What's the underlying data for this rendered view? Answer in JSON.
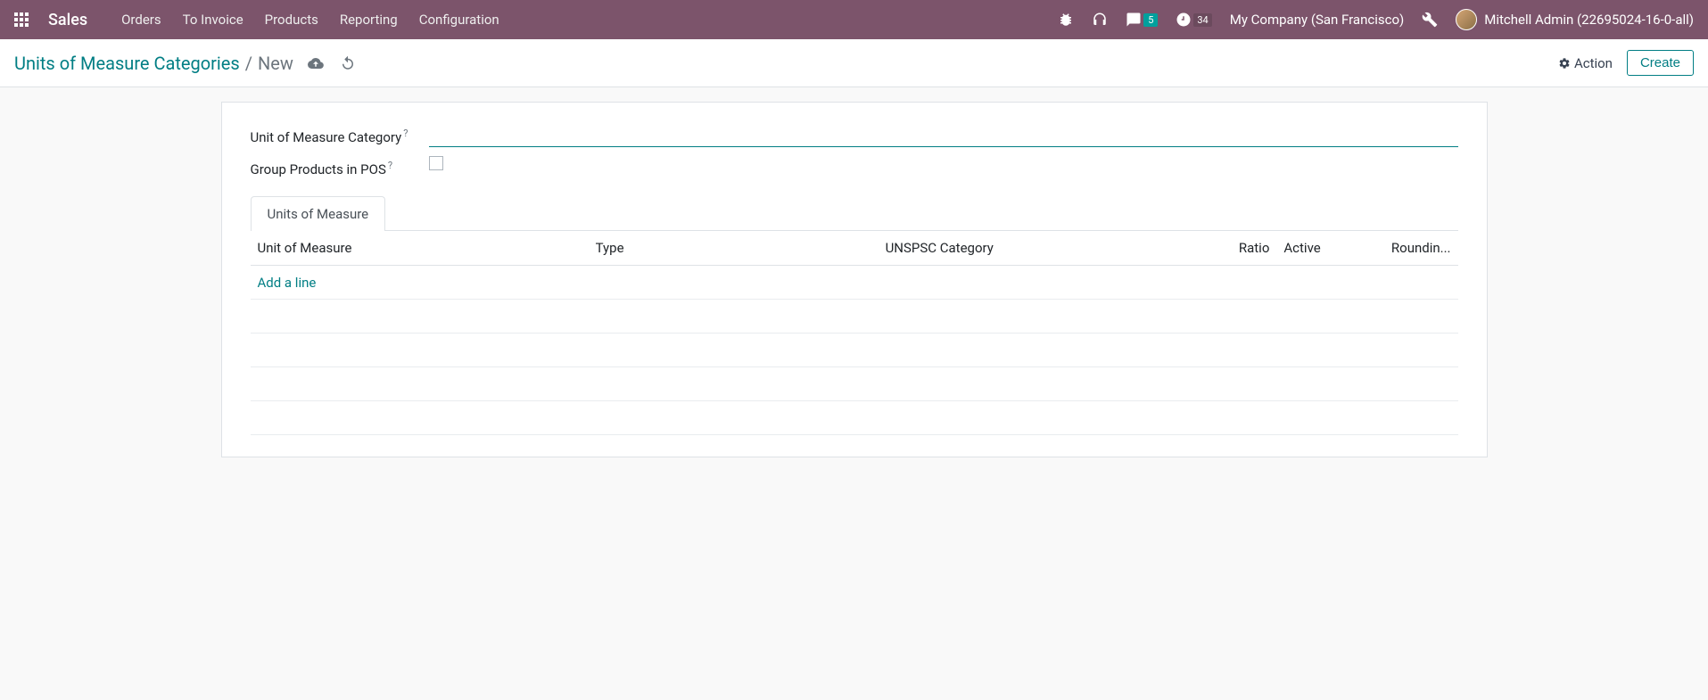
{
  "navbar": {
    "brand": "Sales",
    "menu": [
      "Orders",
      "To Invoice",
      "Products",
      "Reporting",
      "Configuration"
    ],
    "messages_badge": "5",
    "activities_badge": "34",
    "company": "My Company (San Francisco)",
    "user": "Mitchell Admin (22695024-16-0-all)"
  },
  "control_panel": {
    "breadcrumb_link": "Units of Measure Categories",
    "breadcrumb_current": "New",
    "action_label": "Action",
    "create_label": "Create"
  },
  "form": {
    "category_label": "Unit of Measure Category",
    "category_value": "",
    "pos_label": "Group Products in POS",
    "pos_checked": false,
    "help_mark": "?"
  },
  "tabs": {
    "uom_tab": "Units of Measure"
  },
  "table": {
    "columns": {
      "uom": "Unit of Measure",
      "type": "Type",
      "unspsc": "UNSPSC Category",
      "ratio": "Ratio",
      "active": "Active",
      "rounding": "Roundin..."
    },
    "add_line": "Add a line"
  }
}
